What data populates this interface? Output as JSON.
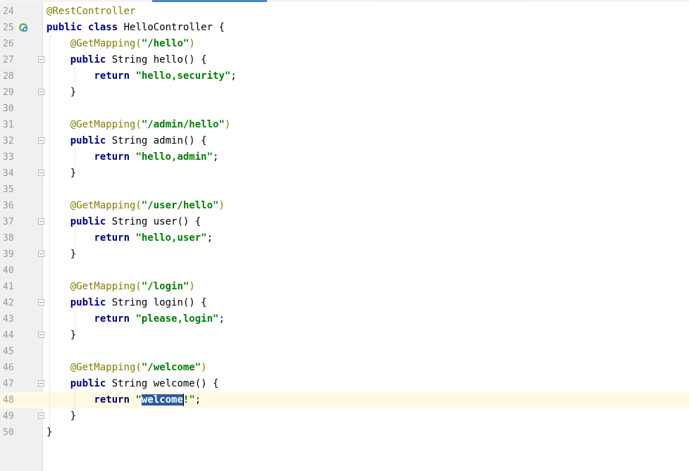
{
  "editor": {
    "language": "java",
    "current_line": 48,
    "colors": {
      "keyword": "#000080",
      "annotation": "#808000",
      "string": "#008000",
      "selection": "#2c5d9b",
      "current_line_bg": "#fffae3",
      "gutter_bg": "#f0f0f0",
      "line_number": "#999999"
    },
    "lines": [
      {
        "num": "24",
        "tokens": [
          {
            "t": "ann",
            "v": "@RestController"
          }
        ]
      },
      {
        "num": "25",
        "icon": "spring-bean-icon",
        "tokens": [
          {
            "t": "kw",
            "v": "public"
          },
          {
            "t": "plain",
            "v": " "
          },
          {
            "t": "kw",
            "v": "class"
          },
          {
            "t": "plain",
            "v": " HelloController {"
          }
        ]
      },
      {
        "num": "26",
        "tokens": [
          {
            "t": "plain",
            "v": "    "
          },
          {
            "t": "ann",
            "v": "@GetMapping("
          },
          {
            "t": "str",
            "v": "\"/hello\""
          },
          {
            "t": "ann",
            "v": ")"
          }
        ]
      },
      {
        "num": "27",
        "fold": "start",
        "tokens": [
          {
            "t": "plain",
            "v": "    "
          },
          {
            "t": "kw",
            "v": "public"
          },
          {
            "t": "plain",
            "v": " String hello() {"
          }
        ]
      },
      {
        "num": "28",
        "tokens": [
          {
            "t": "plain",
            "v": "        "
          },
          {
            "t": "kw",
            "v": "return"
          },
          {
            "t": "plain",
            "v": " "
          },
          {
            "t": "str",
            "v": "\"hello,security\""
          },
          {
            "t": "plain",
            "v": ";"
          }
        ]
      },
      {
        "num": "29",
        "fold": "end",
        "tokens": [
          {
            "t": "plain",
            "v": "    }"
          }
        ]
      },
      {
        "num": "30",
        "tokens": []
      },
      {
        "num": "31",
        "tokens": [
          {
            "t": "plain",
            "v": "    "
          },
          {
            "t": "ann",
            "v": "@GetMapping("
          },
          {
            "t": "str",
            "v": "\"/admin/hello\""
          },
          {
            "t": "ann",
            "v": ")"
          }
        ]
      },
      {
        "num": "32",
        "fold": "start",
        "tokens": [
          {
            "t": "plain",
            "v": "    "
          },
          {
            "t": "kw",
            "v": "public"
          },
          {
            "t": "plain",
            "v": " String admin() {"
          }
        ]
      },
      {
        "num": "33",
        "tokens": [
          {
            "t": "plain",
            "v": "        "
          },
          {
            "t": "kw",
            "v": "return"
          },
          {
            "t": "plain",
            "v": " "
          },
          {
            "t": "str",
            "v": "\"hello,admin\""
          },
          {
            "t": "plain",
            "v": ";"
          }
        ]
      },
      {
        "num": "34",
        "fold": "end",
        "tokens": [
          {
            "t": "plain",
            "v": "    }"
          }
        ]
      },
      {
        "num": "35",
        "tokens": []
      },
      {
        "num": "36",
        "tokens": [
          {
            "t": "plain",
            "v": "    "
          },
          {
            "t": "ann",
            "v": "@GetMapping("
          },
          {
            "t": "str",
            "v": "\"/user/hello\""
          },
          {
            "t": "ann",
            "v": ")"
          }
        ]
      },
      {
        "num": "37",
        "fold": "start",
        "tokens": [
          {
            "t": "plain",
            "v": "    "
          },
          {
            "t": "kw",
            "v": "public"
          },
          {
            "t": "plain",
            "v": " String user() {"
          }
        ]
      },
      {
        "num": "38",
        "tokens": [
          {
            "t": "plain",
            "v": "        "
          },
          {
            "t": "kw",
            "v": "return"
          },
          {
            "t": "plain",
            "v": " "
          },
          {
            "t": "str",
            "v": "\"hello,user\""
          },
          {
            "t": "plain",
            "v": ";"
          }
        ]
      },
      {
        "num": "39",
        "fold": "end",
        "tokens": [
          {
            "t": "plain",
            "v": "    }"
          }
        ]
      },
      {
        "num": "40",
        "tokens": []
      },
      {
        "num": "41",
        "tokens": [
          {
            "t": "plain",
            "v": "    "
          },
          {
            "t": "ann",
            "v": "@GetMapping("
          },
          {
            "t": "str",
            "v": "\"/login\""
          },
          {
            "t": "ann",
            "v": ")"
          }
        ]
      },
      {
        "num": "42",
        "fold": "start",
        "tokens": [
          {
            "t": "plain",
            "v": "    "
          },
          {
            "t": "kw",
            "v": "public"
          },
          {
            "t": "plain",
            "v": " String login() {"
          }
        ]
      },
      {
        "num": "43",
        "tokens": [
          {
            "t": "plain",
            "v": "        "
          },
          {
            "t": "kw",
            "v": "return"
          },
          {
            "t": "plain",
            "v": " "
          },
          {
            "t": "str",
            "v": "\"please,login\""
          },
          {
            "t": "plain",
            "v": ";"
          }
        ]
      },
      {
        "num": "44",
        "fold": "end",
        "tokens": [
          {
            "t": "plain",
            "v": "    }"
          }
        ]
      },
      {
        "num": "45",
        "tokens": []
      },
      {
        "num": "46",
        "tokens": [
          {
            "t": "plain",
            "v": "    "
          },
          {
            "t": "ann",
            "v": "@GetMapping("
          },
          {
            "t": "str",
            "v": "\"/welcome\""
          },
          {
            "t": "ann",
            "v": ")"
          }
        ]
      },
      {
        "num": "47",
        "fold": "start",
        "tokens": [
          {
            "t": "plain",
            "v": "    "
          },
          {
            "t": "kw",
            "v": "public"
          },
          {
            "t": "plain",
            "v": " String welcome() {"
          }
        ]
      },
      {
        "num": "48",
        "tokens": [
          {
            "t": "plain",
            "v": "        "
          },
          {
            "t": "kw",
            "v": "return"
          },
          {
            "t": "plain",
            "v": " "
          },
          {
            "t": "str",
            "v": "\""
          },
          {
            "t": "sel",
            "v": "welcome"
          },
          {
            "t": "caret",
            "v": ""
          },
          {
            "t": "str",
            "v": "!\""
          },
          {
            "t": "plain",
            "v": ";"
          }
        ]
      },
      {
        "num": "49",
        "fold": "end",
        "tokens": [
          {
            "t": "plain",
            "v": "    }"
          }
        ]
      },
      {
        "num": "50",
        "tokens": [
          {
            "t": "plain",
            "v": "}"
          }
        ]
      }
    ]
  }
}
